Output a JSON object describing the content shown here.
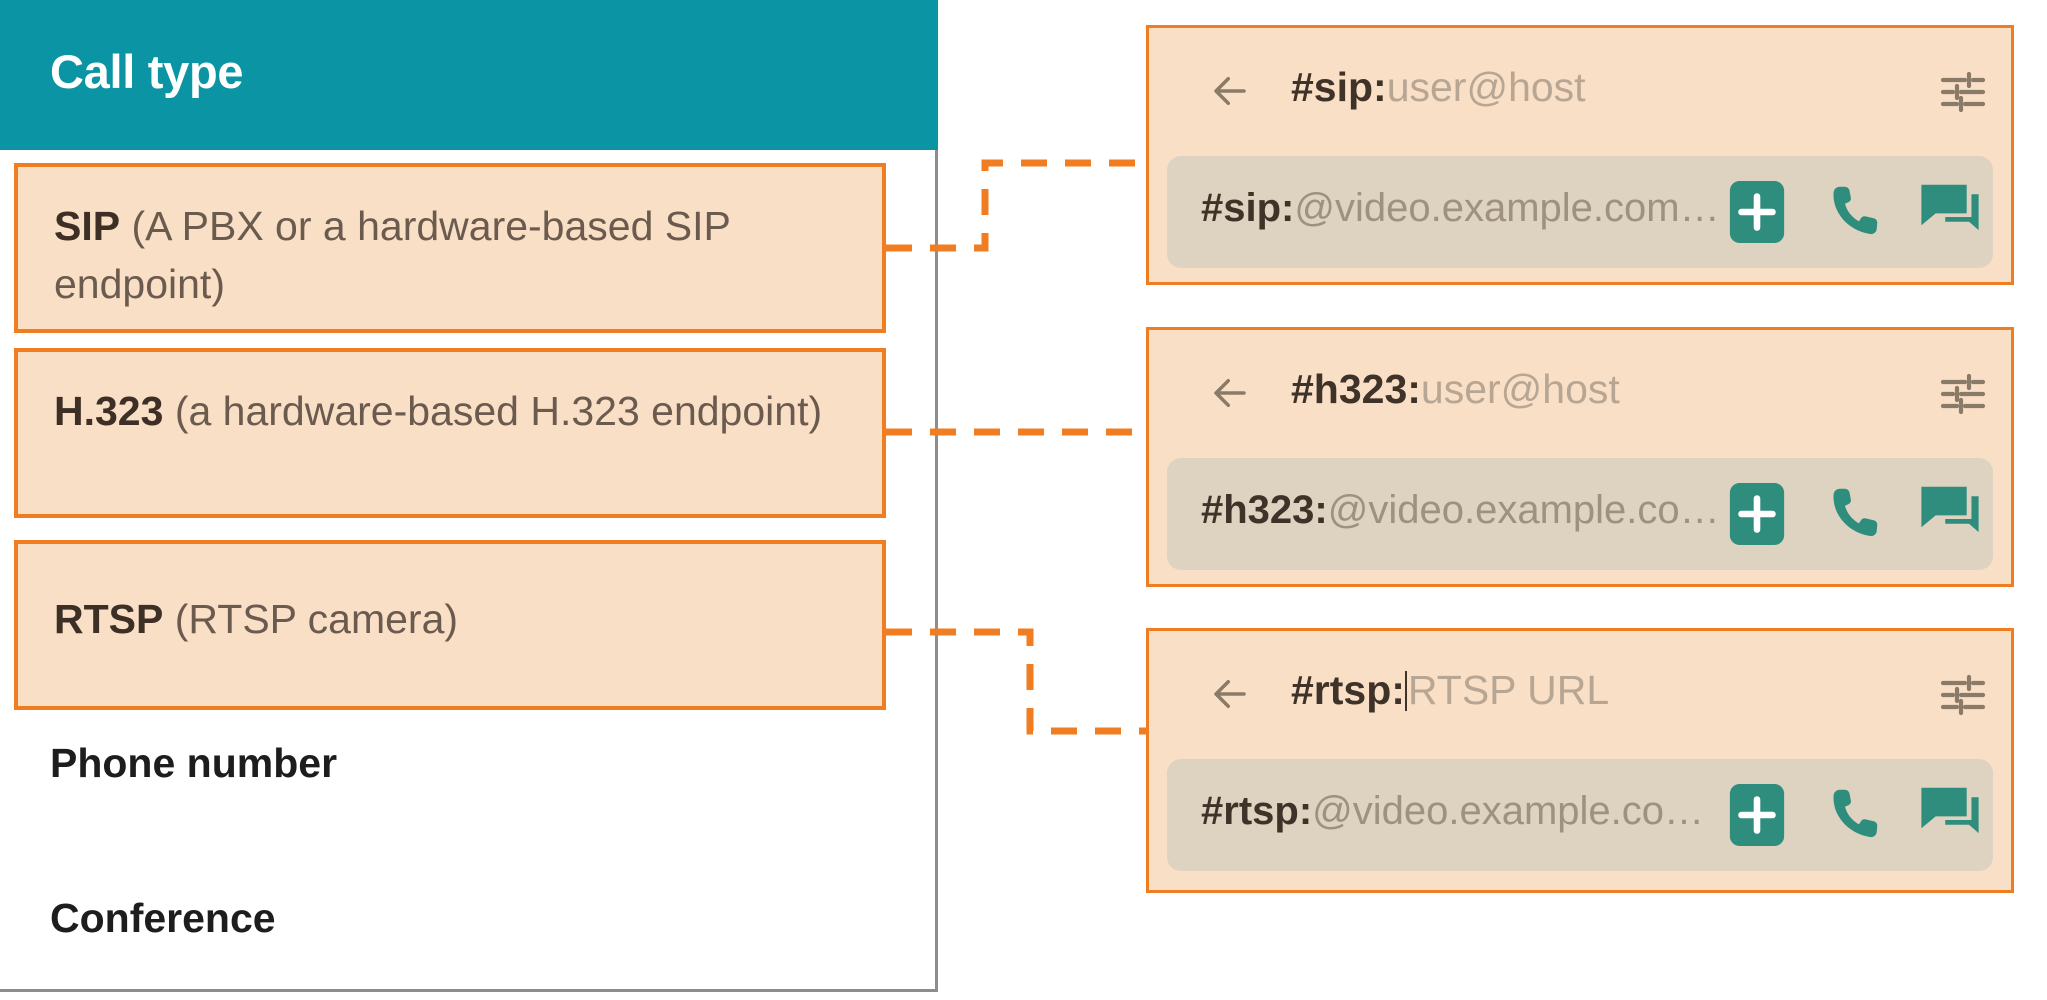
{
  "colors": {
    "header_teal": "#0a94a4",
    "highlight_border": "#f07d22",
    "highlight_fill": "#fadfc7",
    "action_green": "#2f8d7d",
    "input_row_fill": "#ddd3c0",
    "connector": "#f07d22"
  },
  "left_panel": {
    "header": {
      "title": "Call type"
    },
    "options": [
      {
        "id": "sip",
        "label": "SIP",
        "description": "(A PBX or a hardware-based SIP endpoint)",
        "highlighted": true
      },
      {
        "id": "h323",
        "label": "H.323",
        "description": "(a hardware-based H.323 endpoint)",
        "highlighted": true
      },
      {
        "id": "rtsp",
        "label": "RTSP",
        "description": "(RTSP camera)",
        "highlighted": true
      },
      {
        "id": "phone",
        "label": "Phone number",
        "description": "",
        "highlighted": false
      },
      {
        "id": "conference",
        "label": "Conference",
        "description": "",
        "highlighted": false
      }
    ]
  },
  "cards": [
    {
      "id": "sip",
      "back_icon": "arrow-left-icon",
      "title_scheme": "#sip:",
      "title_placeholder": "user@host",
      "has_caret": false,
      "tune_icon": "tune-icon",
      "close_icon": "close-icon",
      "input_scheme": "#sip:",
      "input_rest": "@video.example.com…",
      "add_icon": "plus-icon",
      "call_icon": "phone-icon",
      "chat_icon": "chat-icon"
    },
    {
      "id": "h323",
      "back_icon": "arrow-left-icon",
      "title_scheme": "#h323:",
      "title_placeholder": "user@host",
      "has_caret": false,
      "tune_icon": "tune-icon",
      "close_icon": "close-icon",
      "input_scheme": "#h323:",
      "input_rest": "@video.example.co…",
      "add_icon": "plus-icon",
      "call_icon": "phone-icon",
      "chat_icon": "chat-icon"
    },
    {
      "id": "rtsp",
      "back_icon": "arrow-left-icon",
      "title_scheme": "#rtsp:",
      "title_placeholder": "RTSP URL",
      "has_caret": true,
      "tune_icon": "tune-icon",
      "close_icon": "close-icon",
      "input_scheme": "#rtsp:",
      "input_rest": "@video.example.co…",
      "add_icon": "plus-icon",
      "call_icon": "phone-icon",
      "chat_icon": "chat-icon"
    }
  ]
}
